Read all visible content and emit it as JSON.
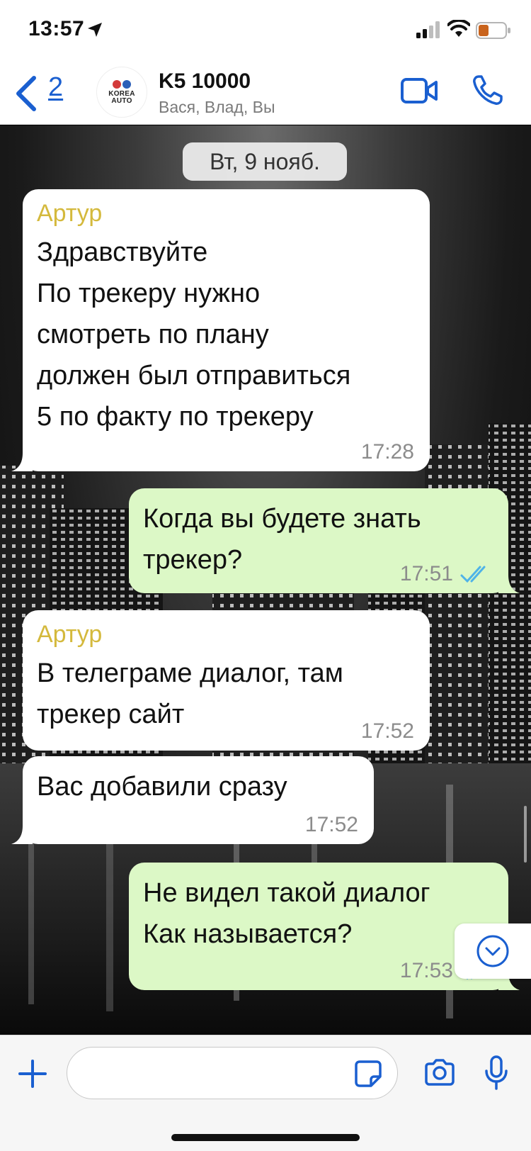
{
  "status_bar": {
    "time": "13:57"
  },
  "header": {
    "back_count": "2",
    "avatar_text_line1": "KOREA",
    "avatar_text_line2": "AUTO",
    "title": "K5 10000",
    "subtitle": "Вася, Влад, Вы"
  },
  "chat": {
    "date_label": "Вт, 9 нояб.",
    "messages": [
      {
        "direction": "in",
        "sender": "Артур",
        "text": "Здравствуйте\nПо трекеру нужно\nсмотреть по плану\nдолжен был отправиться\n5 по факту по трекеру",
        "time": "17:28"
      },
      {
        "direction": "out",
        "text": "Когда вы будете знать\nтрекер?",
        "time": "17:51",
        "status": "read"
      },
      {
        "direction": "in",
        "sender": "Артур",
        "text": "В телеграме диалог, там\nтрекер сайт",
        "time": "17:52"
      },
      {
        "direction": "in",
        "text": "Вас добавили сразу",
        "time": "17:52"
      },
      {
        "direction": "out",
        "text": "Не видел такой диалог\nКак называется?",
        "time": "17:53",
        "status": "read"
      }
    ]
  },
  "input_bar": {
    "placeholder": ""
  },
  "colors": {
    "accent": "#1a5fd0",
    "incoming_bubble": "#ffffff",
    "outgoing_bubble": "#dcf8c6",
    "sender_name": "#d4b93c",
    "read_ticks": "#4fb3e8"
  }
}
